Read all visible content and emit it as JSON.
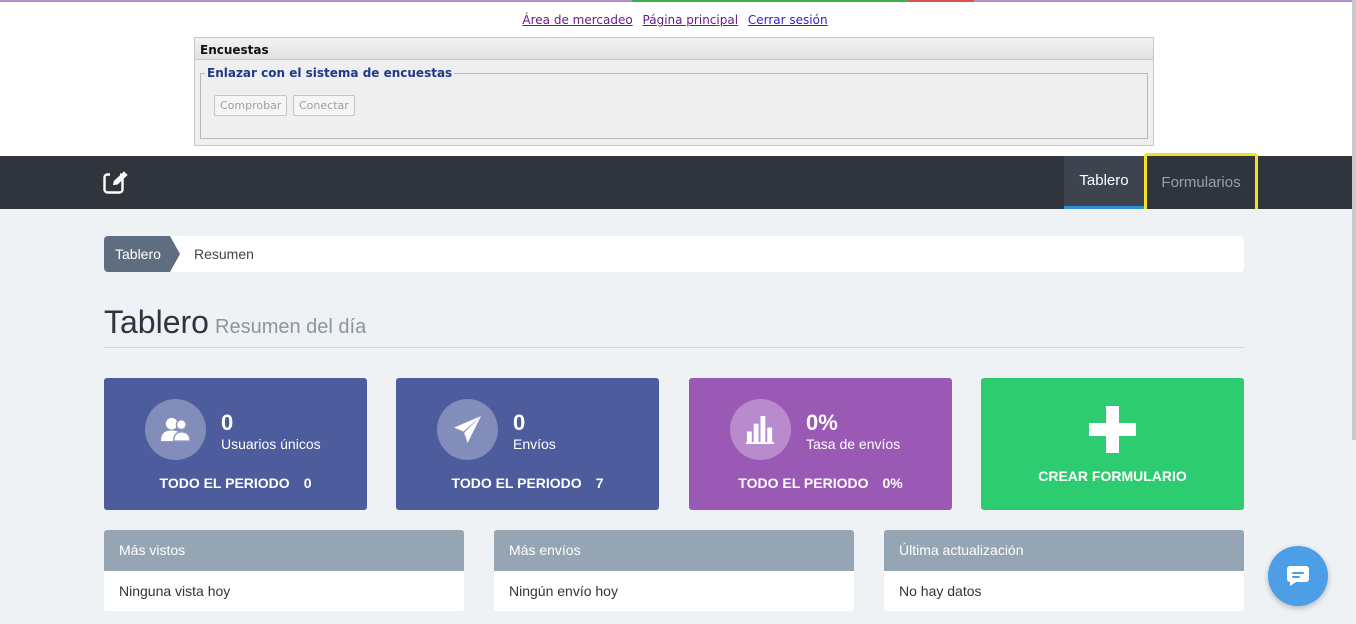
{
  "legacy": {
    "links": [
      "Área de mercadeo",
      "Página principal",
      "Cerrar sesión"
    ],
    "panel_title": "Encuestas",
    "fieldset_legend": "Enlazar con el sistema de encuestas",
    "buttons": {
      "check": "Comprobar",
      "connect": "Conectar"
    }
  },
  "navbar": {
    "logo_icon": "edit-icon",
    "tabs": [
      {
        "label": "Tablero",
        "active": true
      },
      {
        "label": "Formularios",
        "active": false,
        "highlighted": true
      }
    ]
  },
  "breadcrumb": {
    "items": [
      "Tablero",
      "Resumen"
    ]
  },
  "page": {
    "title": "Tablero",
    "subtitle": "Resumen del día"
  },
  "cards": [
    {
      "value": "0",
      "label": "Usuarios únicos",
      "period_label": "TODO EL PERIODO",
      "period_value": "0",
      "icon": "users-icon",
      "color": "#4d5c9c"
    },
    {
      "value": "0",
      "label": "Envíos",
      "period_label": "TODO EL PERIODO",
      "period_value": "7",
      "icon": "paper-plane-icon",
      "color": "#4d5c9c"
    },
    {
      "value": "0%",
      "label": "Tasa de envíos",
      "period_label": "TODO EL PERIODO",
      "period_value": "0%",
      "icon": "bar-chart-icon",
      "color": "#9b59b6"
    }
  ],
  "create_card": {
    "label": "CREAR FORMULARIO",
    "icon": "plus-icon",
    "color": "#2ecc71"
  },
  "panels": [
    {
      "title": "Más vistos",
      "body": "Ninguna vista hoy"
    },
    {
      "title": "Más envíos",
      "body": "Ningún envío hoy"
    },
    {
      "title": "Última actualización",
      "body": "No hay datos"
    }
  ],
  "chat": {
    "icon": "chat-icon",
    "color": "#4c9ee6"
  }
}
